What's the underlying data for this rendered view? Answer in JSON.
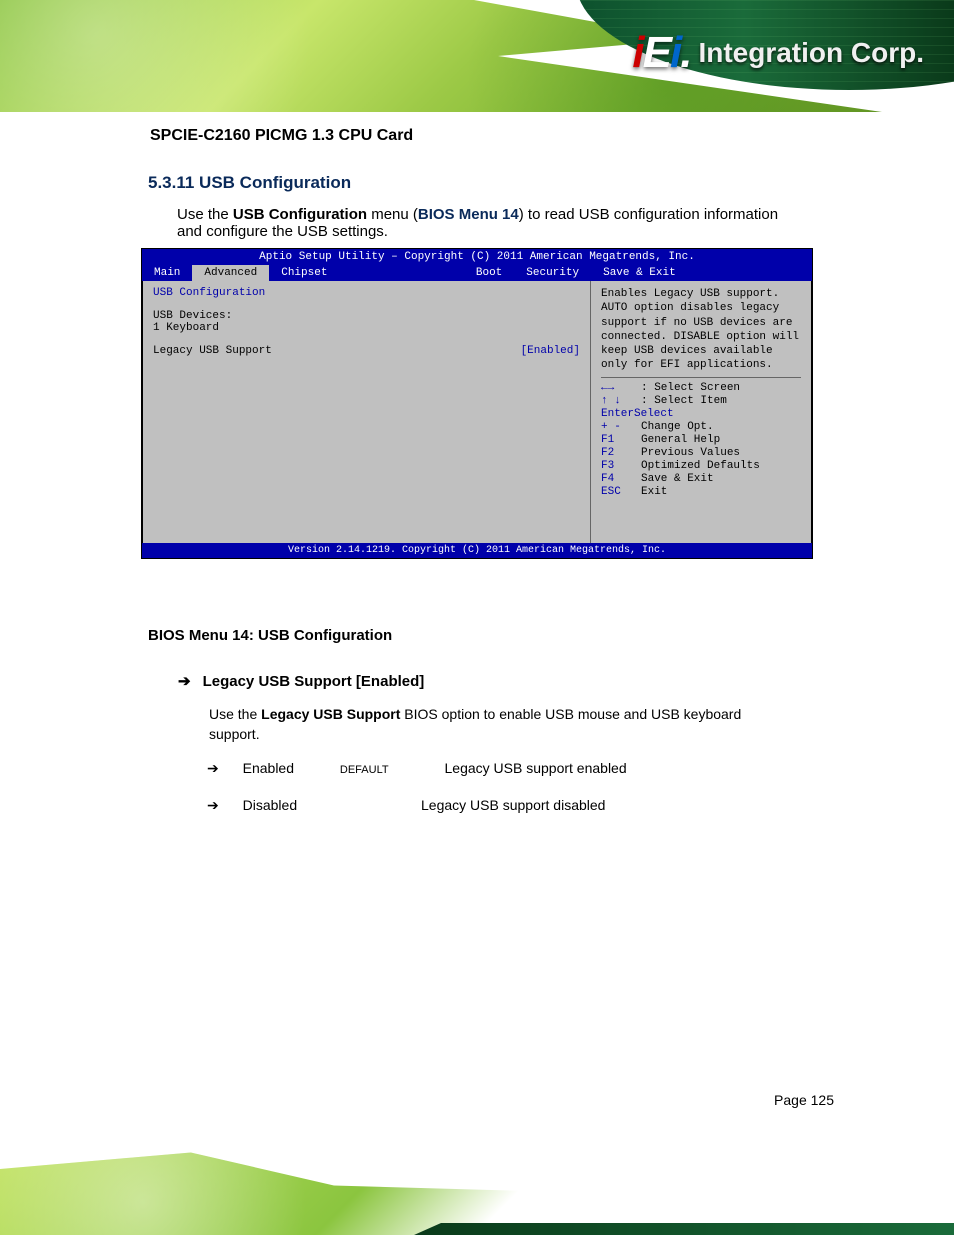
{
  "logo": {
    "letters": "iEi",
    "suffix": "Integration Corp."
  },
  "product_title": "SPCIE-C2160 PICMG 1.3 CPU Card",
  "section_heading": "5.3.11 USB Configuration",
  "intro_text": "Use the USB Configuration menu (BIOS Menu 14) to read USB configuration information and configure the USB settings.",
  "bios": {
    "title": "Aptio Setup Utility – Copyright (C) 2011 American Megatrends, Inc.",
    "tabs": [
      "Main",
      "Advanced",
      "Chipset",
      "Boot",
      "Security",
      "Save & Exit"
    ],
    "active_tab": "Advanced",
    "rows": [
      {
        "label": "USB Configuration",
        "value": ""
      },
      {
        "label": "",
        "value": ""
      },
      {
        "label": "USB Devices:",
        "value": ""
      },
      {
        "label": "    1 Keyboard",
        "value": ""
      },
      {
        "label": "",
        "value": ""
      },
      {
        "label": "Legacy USB Support",
        "value": "[Enabled]"
      }
    ],
    "help_top": "Enables Legacy USB support. AUTO option disables legacy support if no USB devices are connected. DISABLE option will keep USB devices available only for EFI applications.",
    "help_items": [
      {
        "key_sym": "←→",
        "text": ": Select Screen"
      },
      {
        "key_sym": "↑ ↓",
        "text": ": Select Item"
      },
      {
        "key": "EnterSelect",
        "text": ""
      },
      {
        "key": "+ -",
        "text": "Change Opt."
      },
      {
        "key": "F1",
        "text": "General Help"
      },
      {
        "key": "F2",
        "text": "Previous Values"
      },
      {
        "key": "F3",
        "text": "Optimized Defaults"
      },
      {
        "key": "F4",
        "text": "Save & Exit"
      },
      {
        "key": "ESC",
        "text": "Exit"
      }
    ],
    "footer": "Version 2.14.1219. Copyright (C) 2011 American Megatrends, Inc."
  },
  "caption": "BIOS Menu 14: USB Configuration",
  "option": {
    "heading": "Legacy USB Support [Enabled]",
    "description": "Use the Legacy USB Support BIOS option to enable USB mouse and USB keyboard support.",
    "items": [
      {
        "label": "Enabled",
        "default": "DEFAULT",
        "desc": "Legacy USB support enabled"
      },
      {
        "label": "Disabled",
        "default": "",
        "desc": "Legacy USB support disabled"
      }
    ]
  },
  "footer_page": "Page 125"
}
